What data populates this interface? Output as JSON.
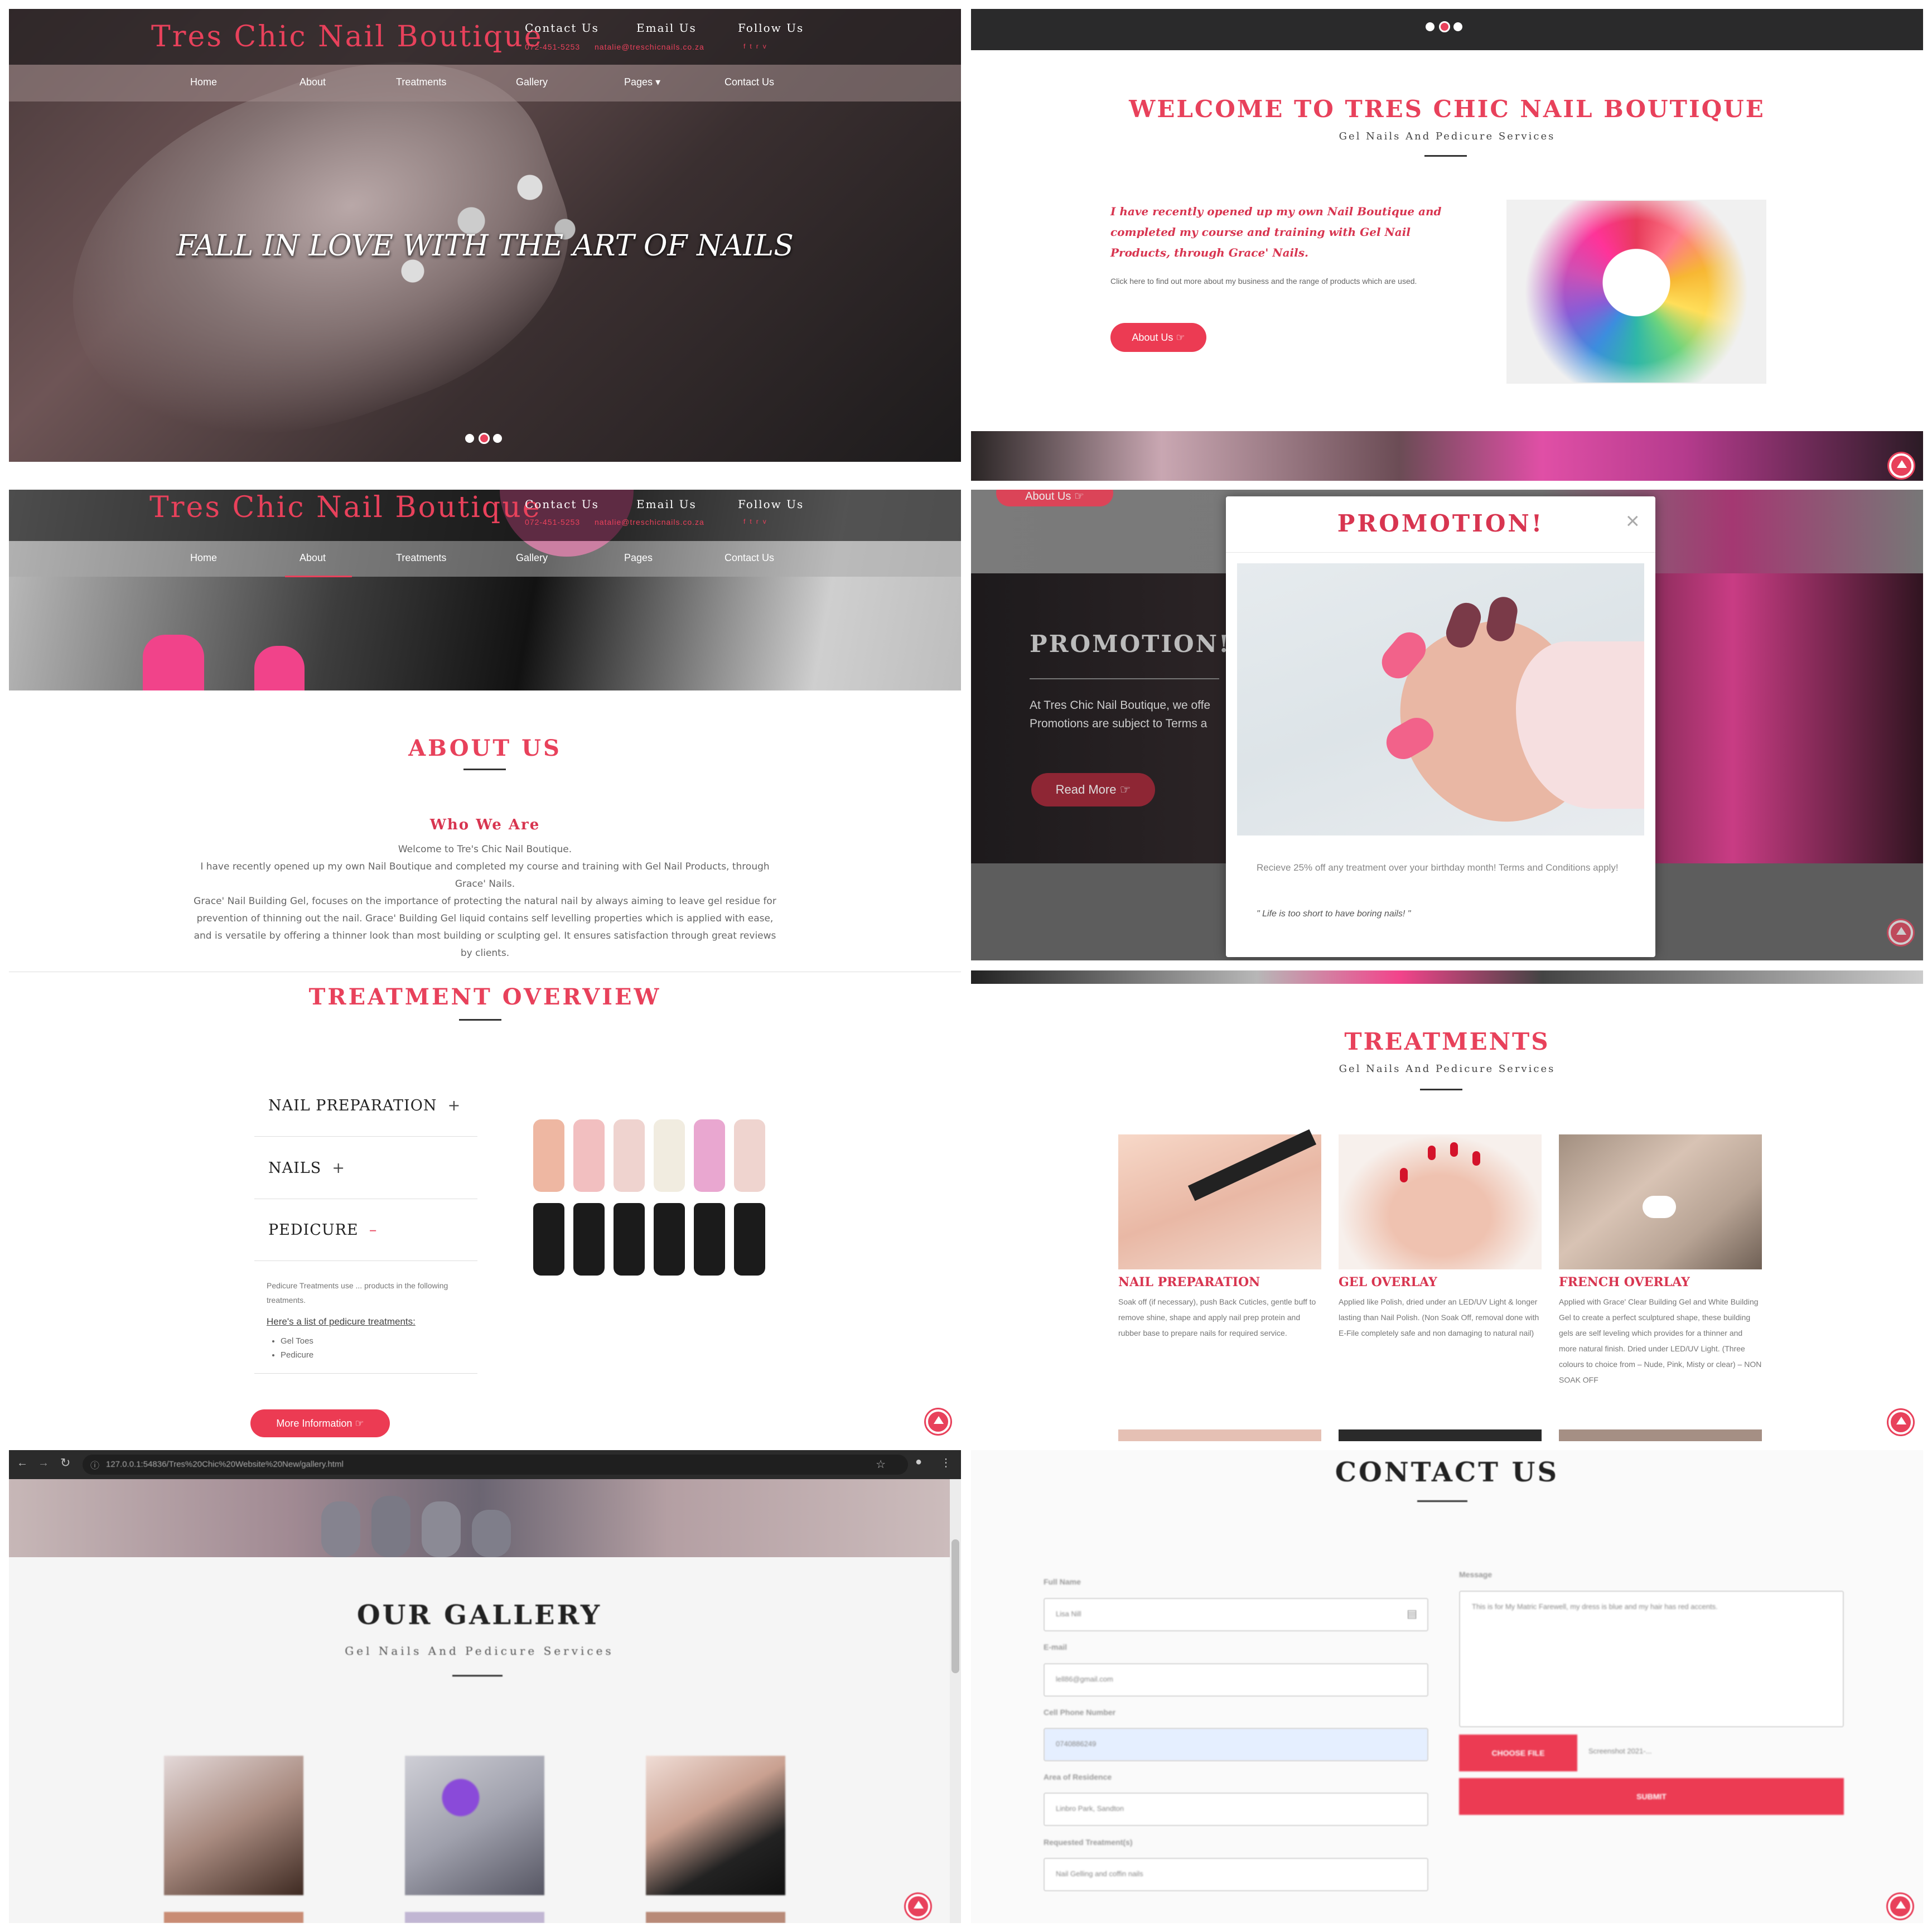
{
  "site": {
    "brand": "Tres Chic Nail Boutique",
    "accent": "#e8415b",
    "header": {
      "contact_label": "Contact Us",
      "email_label": "Email Us",
      "follow_label": "Follow Us",
      "phone": "072-451-5253",
      "email": "natalie@treschicnails.co.za",
      "social_icons": [
        "facebook-icon",
        "twitter-icon",
        "rss-icon",
        "vk-icon"
      ]
    },
    "nav": [
      "Home",
      "About",
      "Treatments",
      "Gallery",
      "Pages",
      "Contact Us"
    ],
    "pages_caret": "▾"
  },
  "hero": {
    "headline": "FALL IN LOVE WITH THE ART OF NAILS"
  },
  "welcome": {
    "title": "WELCOME TO TRES CHIC NAIL BOUTIQUE",
    "subtitle": "Gel Nails And Pedicure Services",
    "intro": "I have recently opened up my own Nail Boutique and completed my course and training with Gel Nail Products, through Grace' Nails.",
    "small": "Click here to find out more about my business and the range of products which are used.",
    "button": "About Us"
  },
  "about": {
    "title": "ABOUT US",
    "heading": "Who We Are",
    "lines": [
      "Welcome to Tre's Chic Nail Boutique.",
      "I have recently opened up my own Nail Boutique and completed my course and training with Gel Nail Products, through",
      "Grace' Nails.",
      "Grace' Nail Building Gel, focuses on the importance of protecting the natural nail by always aiming to leave gel residue for",
      "prevention of thinning out the nail. Grace' Building Gel liquid contains self levelling properties which is applied with ease,",
      "and is versatile by offering a thinner look than most building or sculpting gel. It ensures satisfaction through great reviews",
      "by clients."
    ]
  },
  "promo": {
    "bg_button": "About Us",
    "bg_title": "PROMOTION!",
    "bg_text_1": "At Tres Chic Nail Boutique, we offe",
    "bg_text_2": "Promotions are subject to Terms a",
    "bg_read_more": "Read More",
    "modal_title": "PROMOTION!",
    "close": "×",
    "modal_text": "Recieve 25% off any treatment over your birthday month! Terms and Conditions apply!",
    "quote": "\" Life is too short to have boring nails! \""
  },
  "overview": {
    "title": "TREATMENT OVERVIEW",
    "items": [
      {
        "label": "NAIL PREPARATION",
        "sign": "+"
      },
      {
        "label": "NAILS",
        "sign": "+"
      },
      {
        "label": "PEDICURE",
        "sign": "–"
      }
    ],
    "pedicure_text": "Pedicure Treatments use ... products in the following treatments.",
    "list_heading": "Here's a list of pedicure treatments:",
    "list": [
      "Gel Toes",
      "Pedicure"
    ],
    "button": "More Information"
  },
  "treatments": {
    "title": "TREATMENTS",
    "subtitle": "Gel Nails And Pedicure Services",
    "cards": [
      {
        "title": "NAIL PREPARATION",
        "text": "Soak off (if necessary), push Back Cuticles, gentle buff to remove shine, shape and apply nail prep protein and rubber base to prepare nails for required service."
      },
      {
        "title": "GEL OVERLAY",
        "text": "Applied like Polish, dried under an LED/UV Light & longer lasting than Nail Polish. (Non Soak Off, removal done with E-File completely safe and non damaging to natural nail)"
      },
      {
        "title": "FRENCH OVERLAY",
        "text": "Applied with Grace' Clear Building Gel and White Building Gel to create a perfect sculptured shape, these building gels are self leveling which provides for a thinner and more natural finish. Dried under LED/UV Light. (Three colours to choice from – Nude, Pink, Misty or clear) – NON SOAK OFF"
      }
    ]
  },
  "gallery": {
    "url": "127.0.0.1:54836/Tres%20Chic%20Website%20New/gallery.html",
    "title": "OUR GALLERY",
    "subtitle": "Gel Nails And Pedicure Services"
  },
  "contact": {
    "title": "CONTACT US",
    "fields": [
      {
        "label": "Full Name",
        "value": "Lisa Nill"
      },
      {
        "label": "E-mail",
        "value": "lell86@gmail.com"
      },
      {
        "label": "Cell Phone Number",
        "value": "0740886249"
      },
      {
        "label": "Area of Residence",
        "value": "Linbro Park, Sandton"
      },
      {
        "label": "Requested Treatment(s)",
        "value": "Nail Gelling and coffin nails"
      }
    ],
    "message_label": "Message",
    "message_value": "This is for My Matric Farewell, my dress is blue and my hair has red accents.",
    "choose_file": "CHOOSE FILE",
    "file_name": "Screenshot 2021-...",
    "submit": "SUBMIT"
  }
}
